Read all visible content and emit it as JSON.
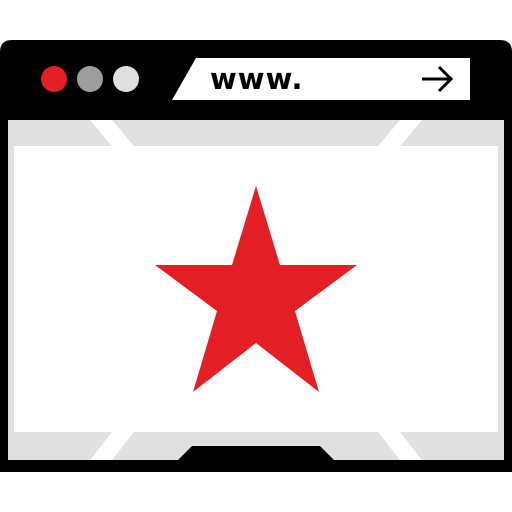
{
  "window": {
    "title_bar_color": "#000000",
    "frame_color": "#000000",
    "content_background": "#ffffff",
    "accent_gray": "#e0e0e0"
  },
  "traffic_lights": [
    {
      "name": "close",
      "color": "#e31e24"
    },
    {
      "name": "minimize",
      "color": "#9e9e9e"
    },
    {
      "name": "maximize",
      "color": "#e0e0e0"
    }
  ],
  "address_bar": {
    "text": "www.",
    "go_icon": "arrow-right-icon",
    "background": "#ffffff"
  },
  "content": {
    "icon": "star-icon",
    "icon_color": "#e31e24"
  }
}
